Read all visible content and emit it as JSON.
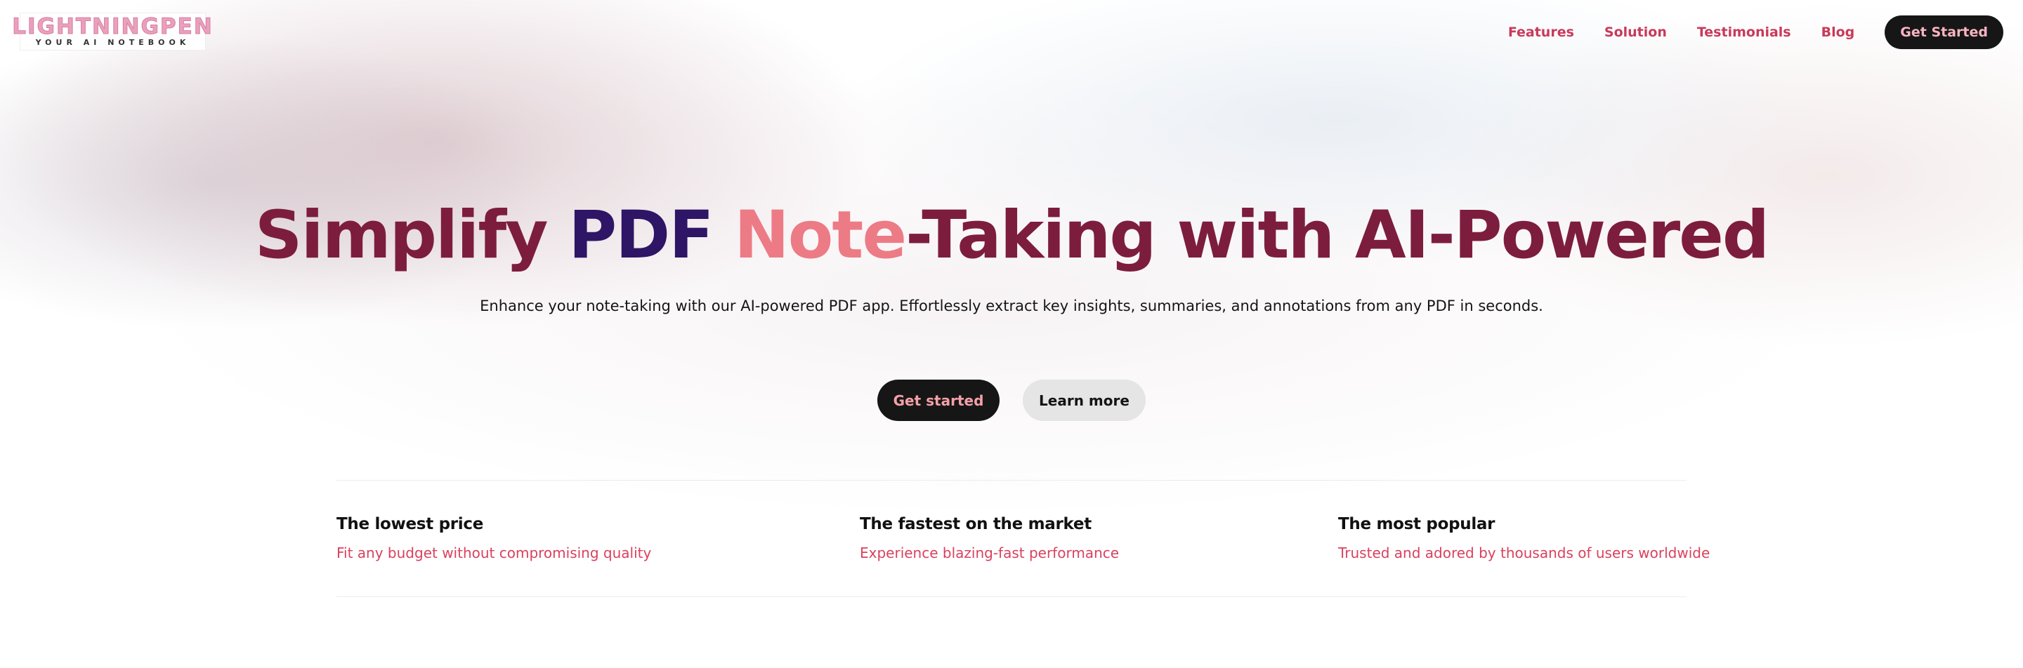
{
  "brand": {
    "logo_word": "LIGHTNINGPEN",
    "logo_tagline": "YOUR AI NOTEBOOK"
  },
  "nav": {
    "links": [
      "Features",
      "Solution",
      "Testimonials",
      "Blog"
    ],
    "cta_label": "Get Started"
  },
  "hero": {
    "title_parts": [
      "Simplify ",
      "PDF ",
      "Note",
      "-Taking with AI-Powered"
    ],
    "subtitle": "Enhance your note-taking with our AI-powered PDF app. Effortlessly extract key insights, summaries, and annotations from any PDF in seconds.",
    "primary_button": "Get started",
    "secondary_button": "Learn more"
  },
  "features": [
    {
      "title": "The lowest price",
      "description": "Fit any budget without compromising quality"
    },
    {
      "title": "The fastest on the market",
      "description": "Experience blazing-fast performance"
    },
    {
      "title": "The most popular",
      "description": "Trusted and adored by thousands of users worldwide"
    }
  ],
  "colors": {
    "accent_dark": "#7d1d3d",
    "accent_purple": "#2e1565",
    "accent_pink": "#ec7b86",
    "link_red": "#c83a5a",
    "button_dark": "#161616"
  }
}
